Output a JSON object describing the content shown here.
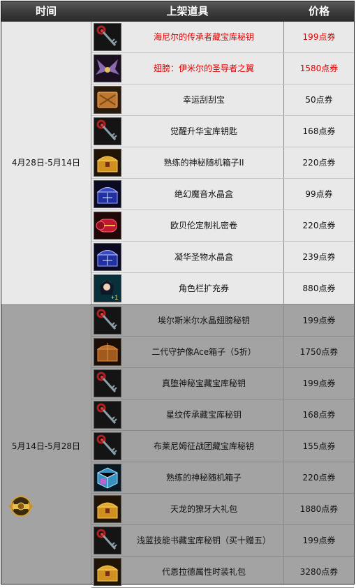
{
  "header": {
    "time": "时间",
    "item": "上架道具",
    "price": "价格"
  },
  "groups": [
    {
      "date": "4月28日-5月14日",
      "items": [
        {
          "icon": "key-icon",
          "name": "海尼尔的传承者藏宝库秘钥",
          "price": "199点券",
          "highlight": true
        },
        {
          "icon": "wings-icon",
          "name": "翅膀：伊米尔的圣导者之翼",
          "price": "1580点券",
          "highlight": true
        },
        {
          "icon": "scratch-card-icon",
          "name": "幸运刮刮宝",
          "price": "50点券",
          "highlight": false
        },
        {
          "icon": "key-icon",
          "name": "觉醒升华宝库钥匙",
          "price": "168点券",
          "highlight": false
        },
        {
          "icon": "gold-chest-icon",
          "name": "熟练的神秘随机箱子II",
          "price": "220点券",
          "highlight": false
        },
        {
          "icon": "crystal-box-icon",
          "name": "绝幻魔音水晶盒",
          "price": "99点券",
          "highlight": false
        },
        {
          "icon": "scroll-icon",
          "name": "欧贝伦定制礼密卷",
          "price": "220点券",
          "highlight": false
        },
        {
          "icon": "crystal-box-icon",
          "name": "凝华圣物水晶盒",
          "price": "239点券",
          "highlight": false
        },
        {
          "icon": "character-slot-icon",
          "name": "角色栏扩充券",
          "price": "880点券",
          "highlight": false
        }
      ]
    },
    {
      "date": "5月14日-5月28日",
      "items": [
        {
          "icon": "key-icon",
          "name": "埃尔斯米尔水晶翅膀秘钥",
          "price": "199点券",
          "highlight": false
        },
        {
          "icon": "bronze-chest-icon",
          "name": "二代守护像Ace箱子（5折）",
          "price": "1750点券",
          "highlight": false
        },
        {
          "icon": "key-icon",
          "name": "真堕神秘宝藏宝库秘钥",
          "price": "199点券",
          "highlight": false
        },
        {
          "icon": "key-icon",
          "name": "星纹传承藏宝库秘钥",
          "price": "168点券",
          "highlight": false
        },
        {
          "icon": "key-icon",
          "name": "布莱尼姆征战团藏宝库秘钥",
          "price": "155点券",
          "highlight": false
        },
        {
          "icon": "blue-cube-icon",
          "name": "熟练的神秘随机箱子",
          "price": "220点券",
          "highlight": false
        },
        {
          "icon": "gold-chest-icon",
          "name": "天龙的獠牙大礼包",
          "price": "1880点券",
          "highlight": false
        },
        {
          "icon": "key-icon",
          "name": "浅蓝技能书藏宝库秘钥（买十赠五）",
          "price": "199点券",
          "highlight": false
        },
        {
          "icon": "gold-chest-icon",
          "name": "代恩拉德属性时装礼包",
          "price": "3280点券",
          "highlight": false
        }
      ]
    }
  ],
  "colors": {
    "highlight": "#e00000",
    "group1_bg": "#e9e9e9",
    "group2_bg": "#a3a3a3",
    "header_bg": "#3a3a3a"
  }
}
